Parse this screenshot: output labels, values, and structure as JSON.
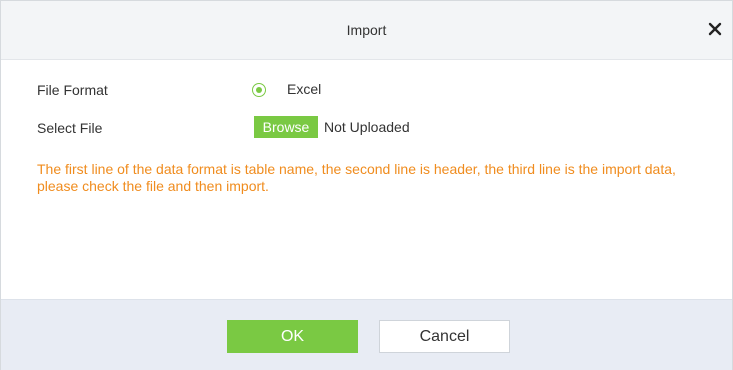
{
  "dialog": {
    "title": "Import",
    "close_icon": "close-icon"
  },
  "form": {
    "file_format_label": "File Format",
    "file_format_option": "Excel",
    "file_format_selected": true,
    "select_file_label": "Select File",
    "browse_label": "Browse",
    "upload_status": "Not Uploaded",
    "hint": "The first line of the data format is table name, the second line is header, the third line is the import data, please check the file and then import."
  },
  "footer": {
    "ok_label": "OK",
    "cancel_label": "Cancel"
  },
  "colors": {
    "accent": "#7ac943",
    "hint": "#f08c1e",
    "footer_bg": "#e8ecf4",
    "titlebar_bg": "#f3f5f7"
  }
}
